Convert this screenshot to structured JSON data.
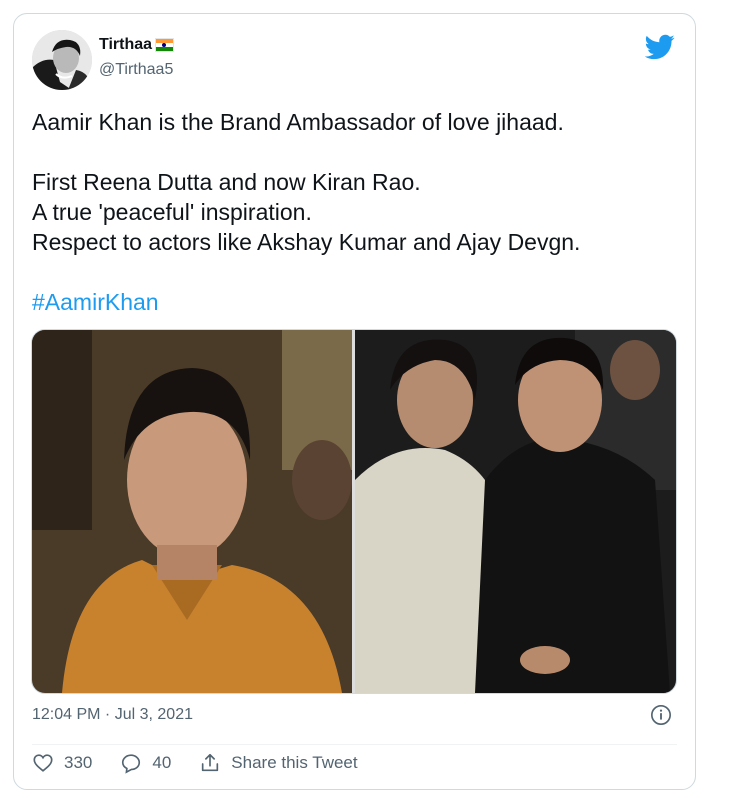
{
  "tweet": {
    "display_name": "Tirthaa",
    "handle": "@Tirthaa5",
    "text": "Aamir Khan is the Brand Ambassador of love jihaad.\n\nFirst Reena Dutta and now Kiran Rao.\nA true 'peaceful' inspiration.\nRespect to actors like Akshay Kumar and Ajay Devgn.",
    "hashtag": "#AamirKhan",
    "timestamp": "12:04 PM · Jul 3, 2021",
    "likes": "330",
    "replies": "40",
    "share_label": "Share this Tweet"
  },
  "icons": {
    "brand": "twitter-bird-icon",
    "flag": "india-flag-icon",
    "info": "info-icon",
    "like": "heart-icon",
    "reply": "reply-icon",
    "share": "share-icon"
  },
  "colors": {
    "accent": "#1d9bf0",
    "text": "#0f1419",
    "secondary": "#536471",
    "border": "#cfd9de"
  }
}
